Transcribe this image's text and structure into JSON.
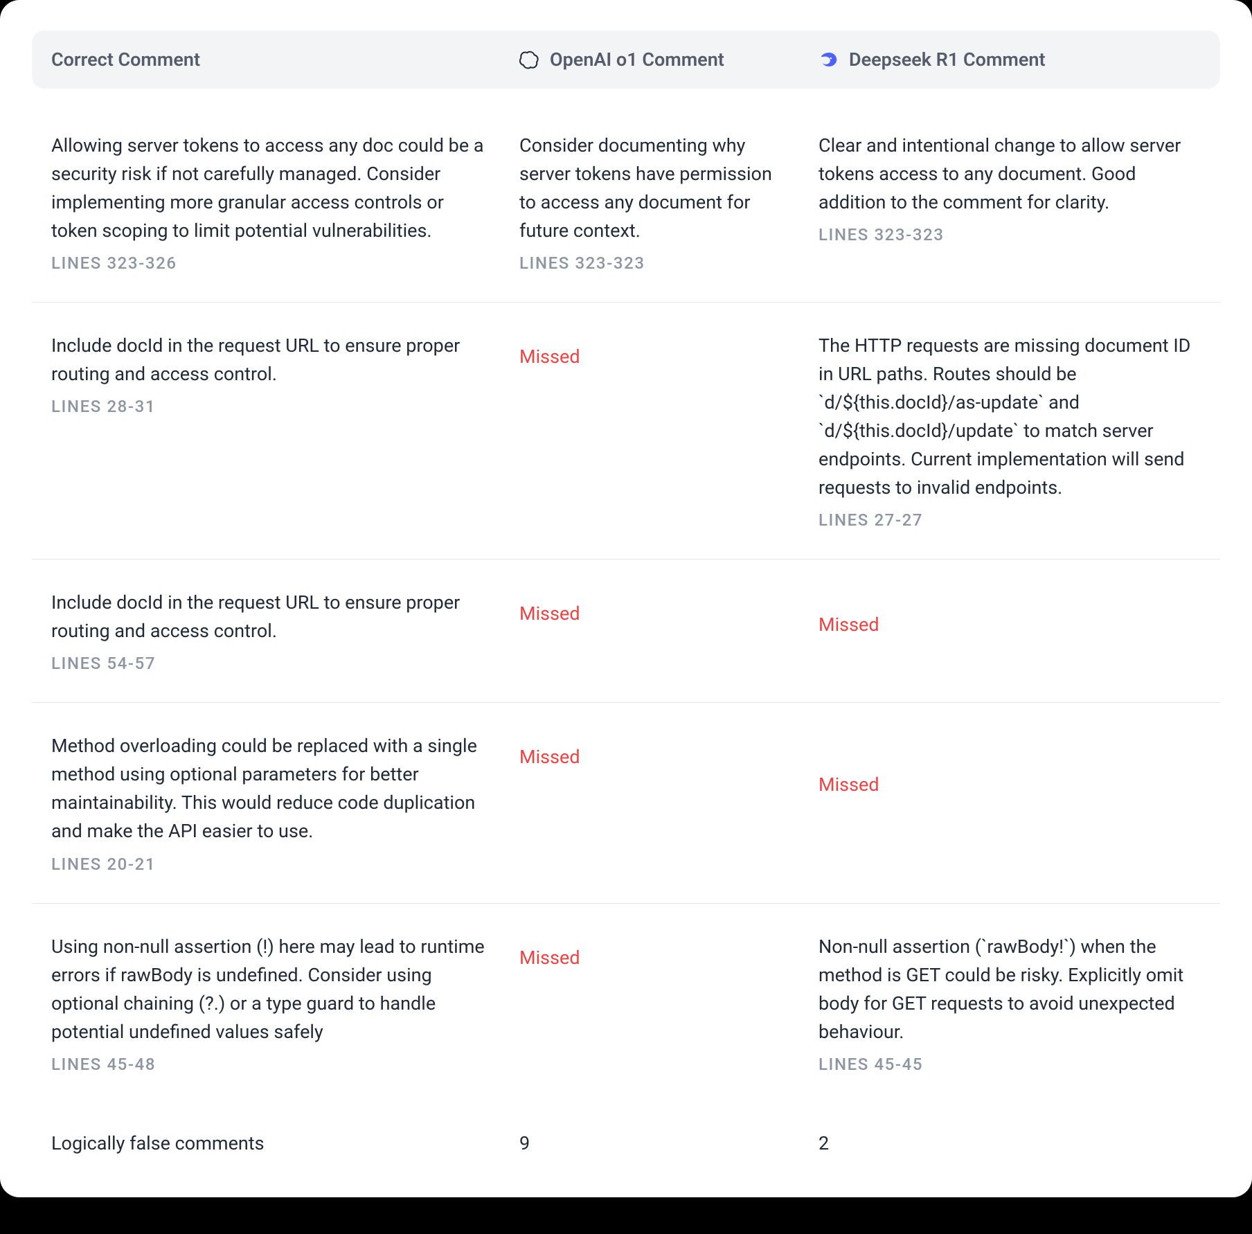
{
  "headers": {
    "correct": "Correct Comment",
    "openai": "OpenAI o1 Comment",
    "deepseek": "Deepseek R1 Comment"
  },
  "missed_label": "Missed",
  "rows": [
    {
      "correct_text": "Allowing server tokens to access any doc could be a security risk if not carefully managed. Consider implementing more granular access controls or token scoping to limit potential vulnerabilities.",
      "correct_lines": "LINES 323-326",
      "openai_text": "Consider documenting why server tokens have permission to access any document for future context.",
      "openai_lines": "LINES 323-323",
      "openai_missed": false,
      "deepseek_text": "Clear and intentional change to allow server tokens access to any document. Good addition to the comment for clarity.",
      "deepseek_lines": "LINES 323-323",
      "deepseek_missed": false
    },
    {
      "correct_text": "Include docId in the request URL to ensure proper routing and access control.",
      "correct_lines": "LINES 28-31",
      "openai_text": "",
      "openai_lines": "",
      "openai_missed": true,
      "deepseek_text": "The HTTP requests are missing document ID in URL paths. Routes should be `d/${this.docId}/as-update` and `d/${this.docId}/update` to match server endpoints. Current implementation will send requests to invalid endpoints.",
      "deepseek_lines": "LINES 27-27",
      "deepseek_missed": false
    },
    {
      "correct_text": "Include docId in the request URL to ensure proper routing and access control.",
      "correct_lines": "LINES 54-57",
      "openai_text": "",
      "openai_lines": "",
      "openai_missed": true,
      "deepseek_text": "",
      "deepseek_lines": "",
      "deepseek_missed": true
    },
    {
      "correct_text": "Method overloading could be replaced with a single method using optional parameters for better maintainability. This would reduce code duplication and make the API easier to use.",
      "correct_lines": "LINES 20-21",
      "openai_text": "",
      "openai_lines": "",
      "openai_missed": true,
      "deepseek_text": "",
      "deepseek_lines": "",
      "deepseek_missed": true
    },
    {
      "correct_text": "Using non-null assertion (!) here may lead to runtime errors if rawBody is undefined. Consider using optional chaining (?.) or a type guard to handle potential undefined values safely",
      "correct_lines": "LINES 45-48",
      "openai_text": "",
      "openai_lines": "",
      "openai_missed": true,
      "deepseek_text": "Non-null assertion (`rawBody!`) when the method is GET could be risky. Explicitly omit body for GET requests to avoid unexpected behaviour.",
      "deepseek_lines": "LINES 45-45",
      "deepseek_missed": false
    }
  ],
  "summary": {
    "label": "Logically false comments",
    "openai_count": "9",
    "deepseek_count": "2"
  }
}
